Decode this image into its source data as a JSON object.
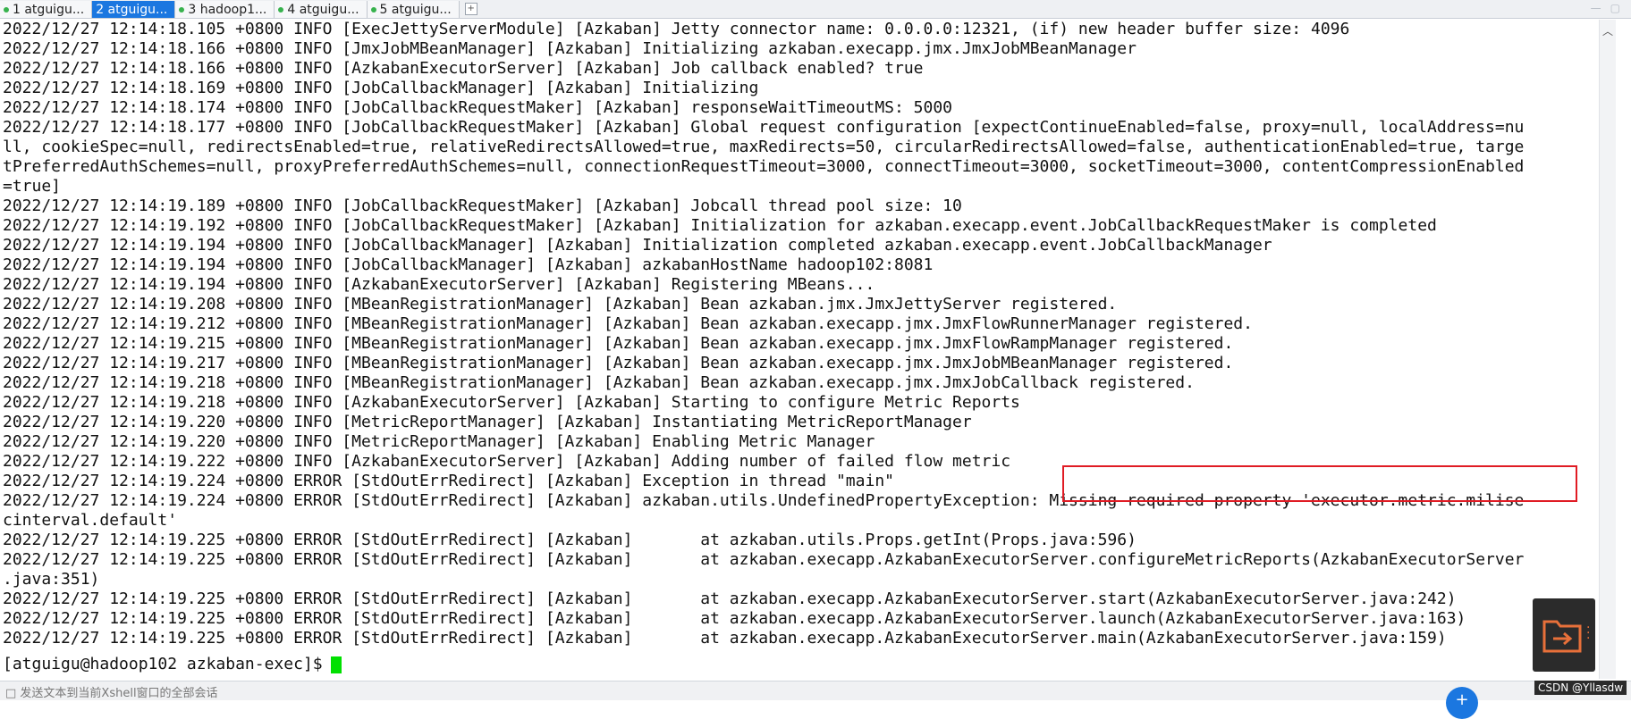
{
  "tabs": [
    {
      "label": "1 atguigu...",
      "active": false
    },
    {
      "label": "2 atguigu...",
      "active": true
    },
    {
      "label": "3 hadoop1...",
      "active": false
    },
    {
      "label": "4 atguigu...",
      "active": false
    },
    {
      "label": "5 atguigu...",
      "active": false
    }
  ],
  "tab_add_label": "+",
  "terminal": {
    "lines": [
      "2022/12/27 12:14:18.105 +0800 INFO [ExecJettyServerModule] [Azkaban] Jetty connector name: 0.0.0.0:12321, (if) new header buffer size: 4096",
      "2022/12/27 12:14:18.166 +0800 INFO [JmxJobMBeanManager] [Azkaban] Initializing azkaban.execapp.jmx.JmxJobMBeanManager",
      "2022/12/27 12:14:18.166 +0800 INFO [AzkabanExecutorServer] [Azkaban] Job callback enabled? true",
      "2022/12/27 12:14:18.169 +0800 INFO [JobCallbackManager] [Azkaban] Initializing",
      "2022/12/27 12:14:18.174 +0800 INFO [JobCallbackRequestMaker] [Azkaban] responseWaitTimeoutMS: 5000",
      "2022/12/27 12:14:18.177 +0800 INFO [JobCallbackRequestMaker] [Azkaban] Global request configuration [expectContinueEnabled=false, proxy=null, localAddress=nu",
      "ll, cookieSpec=null, redirectsEnabled=true, relativeRedirectsAllowed=true, maxRedirects=50, circularRedirectsAllowed=false, authenticationEnabled=true, targe",
      "tPreferredAuthSchemes=null, proxyPreferredAuthSchemes=null, connectionRequestTimeout=3000, connectTimeout=3000, socketTimeout=3000, contentCompressionEnabled",
      "=true]",
      "2022/12/27 12:14:19.189 +0800 INFO [JobCallbackRequestMaker] [Azkaban] Jobcall thread pool size: 10",
      "2022/12/27 12:14:19.192 +0800 INFO [JobCallbackRequestMaker] [Azkaban] Initialization for azkaban.execapp.event.JobCallbackRequestMaker is completed",
      "2022/12/27 12:14:19.194 +0800 INFO [JobCallbackManager] [Azkaban] Initialization completed azkaban.execapp.event.JobCallbackManager",
      "2022/12/27 12:14:19.194 +0800 INFO [JobCallbackManager] [Azkaban] azkabanHostName hadoop102:8081",
      "2022/12/27 12:14:19.194 +0800 INFO [AzkabanExecutorServer] [Azkaban] Registering MBeans...",
      "2022/12/27 12:14:19.208 +0800 INFO [MBeanRegistrationManager] [Azkaban] Bean azkaban.jmx.JmxJettyServer registered.",
      "2022/12/27 12:14:19.212 +0800 INFO [MBeanRegistrationManager] [Azkaban] Bean azkaban.execapp.jmx.JmxFlowRunnerManager registered.",
      "2022/12/27 12:14:19.215 +0800 INFO [MBeanRegistrationManager] [Azkaban] Bean azkaban.execapp.jmx.JmxFlowRampManager registered.",
      "2022/12/27 12:14:19.217 +0800 INFO [MBeanRegistrationManager] [Azkaban] Bean azkaban.execapp.jmx.JmxJobMBeanManager registered.",
      "2022/12/27 12:14:19.218 +0800 INFO [MBeanRegistrationManager] [Azkaban] Bean azkaban.execapp.jmx.JmxJobCallback registered.",
      "2022/12/27 12:14:19.218 +0800 INFO [AzkabanExecutorServer] [Azkaban] Starting to configure Metric Reports",
      "2022/12/27 12:14:19.220 +0800 INFO [MetricReportManager] [Azkaban] Instantiating MetricReportManager",
      "2022/12/27 12:14:19.220 +0800 INFO [MetricReportManager] [Azkaban] Enabling Metric Manager",
      "2022/12/27 12:14:19.222 +0800 INFO [AzkabanExecutorServer] [Azkaban] Adding number of failed flow metric",
      "2022/12/27 12:14:19.224 +0800 ERROR [StdOutErrRedirect] [Azkaban] Exception in thread \"main\"",
      "2022/12/27 12:14:19.224 +0800 ERROR [StdOutErrRedirect] [Azkaban] azkaban.utils.UndefinedPropertyException: Missing required property 'executor.metric.milise",
      "cinterval.default'",
      "2022/12/27 12:14:19.225 +0800 ERROR [StdOutErrRedirect] [Azkaban]       at azkaban.utils.Props.getInt(Props.java:596)",
      "2022/12/27 12:14:19.225 +0800 ERROR [StdOutErrRedirect] [Azkaban]       at azkaban.execapp.AzkabanExecutorServer.configureMetricReports(AzkabanExecutorServer",
      ".java:351)",
      "2022/12/27 12:14:19.225 +0800 ERROR [StdOutErrRedirect] [Azkaban]       at azkaban.execapp.AzkabanExecutorServer.start(AzkabanExecutorServer.java:242)",
      "2022/12/27 12:14:19.225 +0800 ERROR [StdOutErrRedirect] [Azkaban]       at azkaban.execapp.AzkabanExecutorServer.launch(AzkabanExecutorServer.java:163)",
      "2022/12/27 12:14:19.225 +0800 ERROR [StdOutErrRedirect] [Azkaban]       at azkaban.execapp.AzkabanExecutorServer.main(AzkabanExecutorServer.java:159)"
    ],
    "prompt": "[atguigu@hadoop102 azkaban-exec]$",
    "highlight_color": "#e01b24",
    "cursor_color": "#00e000"
  },
  "status_bar": {
    "text": "□ 发送文本到当前Xshell窗口的全部会话"
  },
  "watermark": "CSDN @Yllasdw",
  "colors": {
    "active_tab": "#1b77e0",
    "widget_bg": "#2b2b2b",
    "folder": "#e8703a"
  }
}
